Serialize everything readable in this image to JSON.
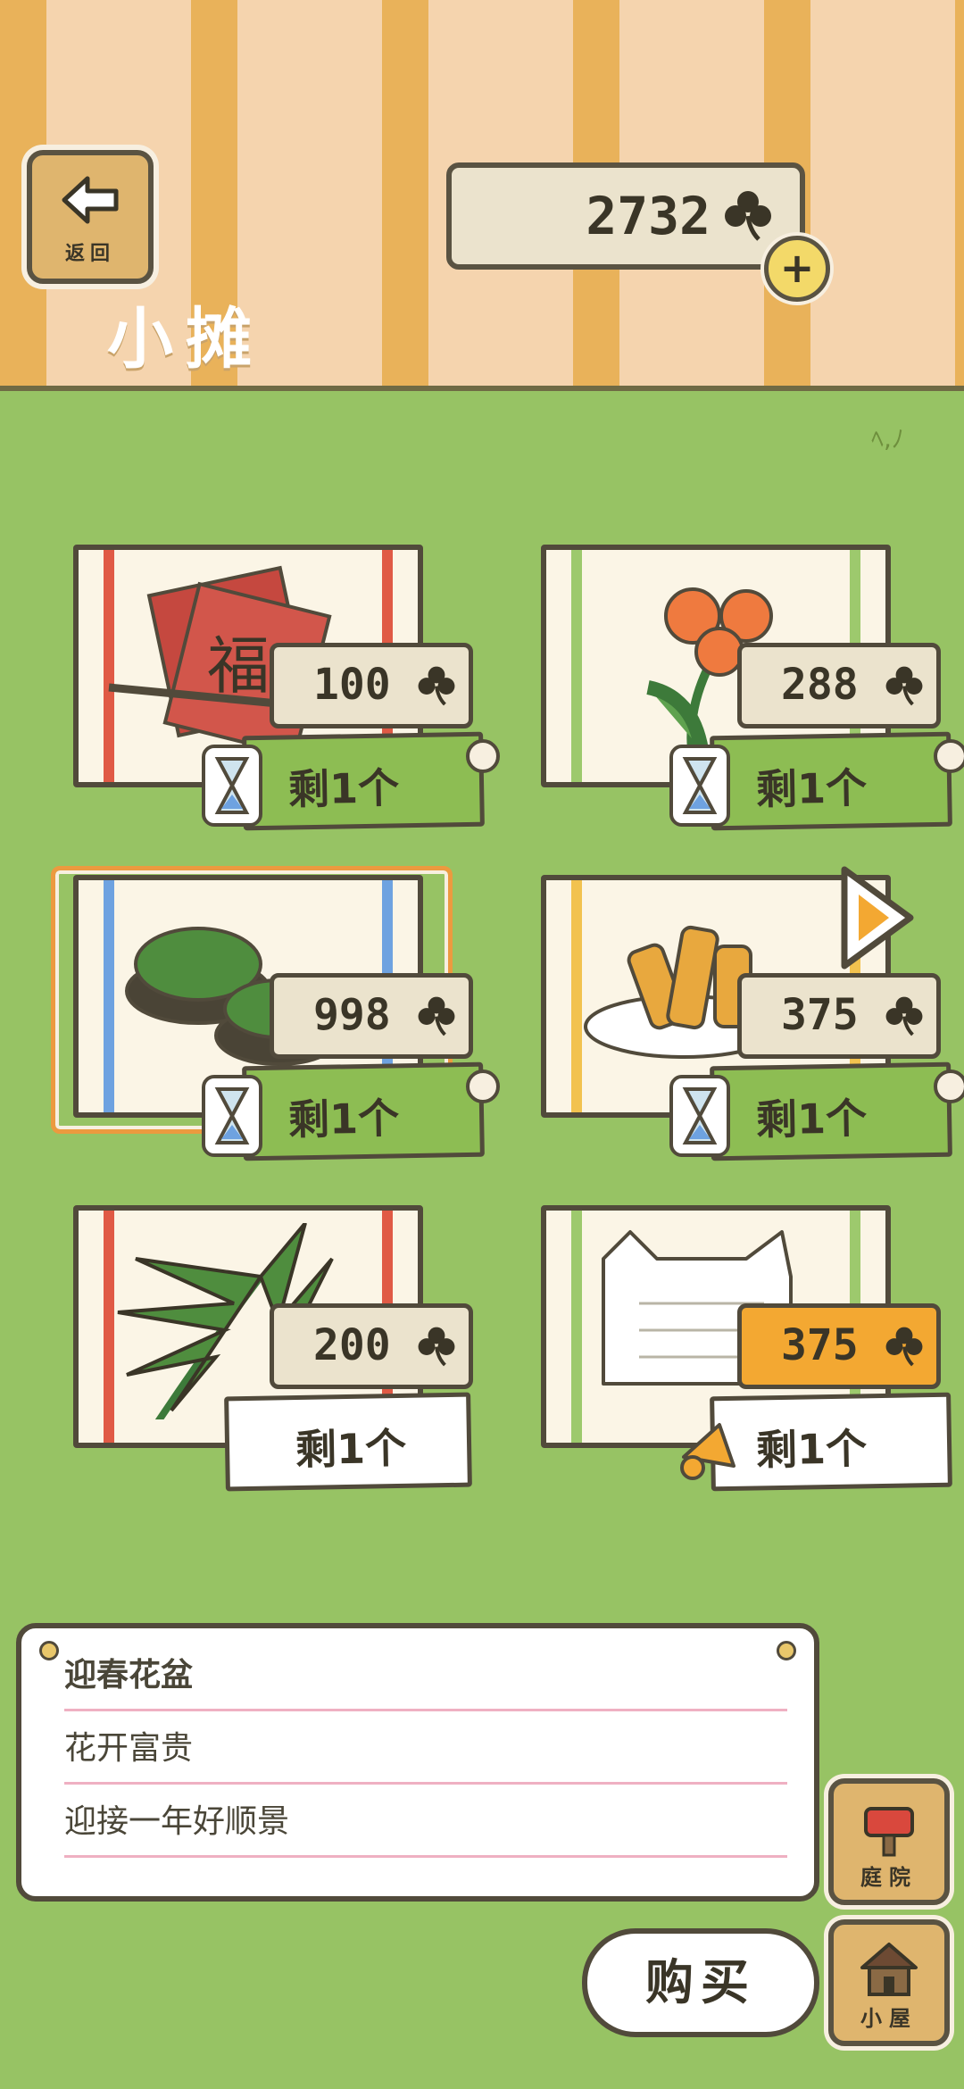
{
  "header": {
    "back_label": "返回",
    "currency_value": "2732",
    "page_title": "小摊"
  },
  "items": [
    {
      "price": "100",
      "stock": "剩1个",
      "stripe": "#e05a45",
      "art": "couplet-paper-icon"
    },
    {
      "price": "288",
      "stock": "剩1个",
      "stripe": "#9dc96d",
      "art": "lily-flower-icon"
    },
    {
      "price": "998",
      "stock": "剩1个",
      "stripe": "#6ea2e0",
      "art": "flower-pot-icon"
    },
    {
      "price": "375",
      "stock": "剩1个",
      "stripe": "#f2c24f",
      "art": "spring-roll-icon"
    },
    {
      "price": "200",
      "stock": "剩1个",
      "stripe": "#e05a45",
      "art": "palm-leaf-icon"
    },
    {
      "price": "375",
      "stock": "剩1个",
      "stripe": "#9dc96d",
      "art": "cat-letter-icon"
    }
  ],
  "description": {
    "name": "迎春花盆",
    "line2": "花开富贵",
    "line3": "迎接一年好顺景"
  },
  "buttons": {
    "buy": "购买",
    "yard": "庭院",
    "house": "小屋"
  },
  "colors": {
    "background": "#97c364",
    "selected_border": "#ec9a3f",
    "highlight_price": "#f3a832"
  }
}
